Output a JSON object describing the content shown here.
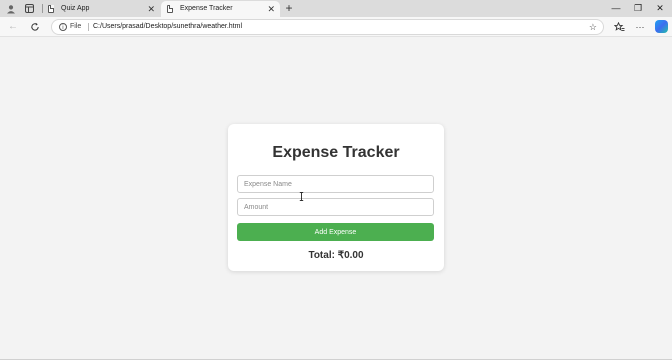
{
  "browser": {
    "tabs": [
      {
        "label": "Quiz App",
        "active": false
      },
      {
        "label": "Expense Tracker",
        "active": true
      }
    ],
    "new_tab_glyph": "+",
    "close_glyph": "✕",
    "window_controls": {
      "minimize": "—",
      "maximize": "❐",
      "close": "✕"
    },
    "address": {
      "scheme_label": "File",
      "url": "C:/Users/prasad/Desktop/sunethra/weather.html"
    },
    "icons": [
      "profile-icon",
      "workspaces-icon",
      "back-icon",
      "refresh-icon",
      "info-icon",
      "favorite-star-icon",
      "favorites-icon",
      "more-icon",
      "copilot-icon"
    ]
  },
  "app": {
    "title": "Expense Tracker",
    "name_field": {
      "placeholder": "Expense Name",
      "value": ""
    },
    "amount_field": {
      "placeholder": "Amount",
      "value": ""
    },
    "add_button_label": "Add Expense",
    "total_text": "Total: ₹0.00",
    "accent_color": "#4caf50"
  }
}
